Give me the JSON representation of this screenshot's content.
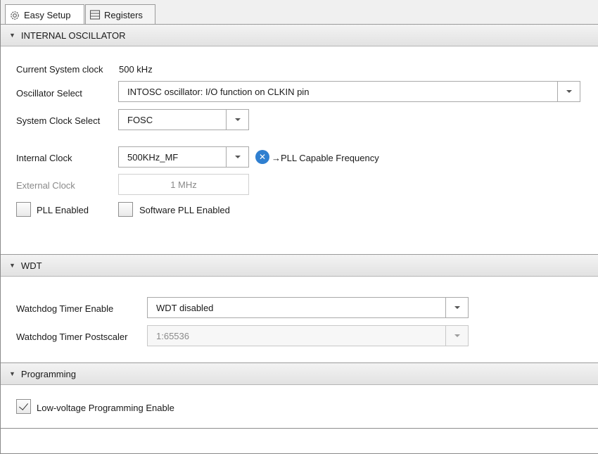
{
  "tabs": [
    {
      "label": "Easy Setup",
      "icon": "gear-icon",
      "active": true
    },
    {
      "label": "Registers",
      "icon": "list-icon",
      "active": false
    }
  ],
  "internal_oscillator": {
    "title": "INTERNAL OSCILLATOR",
    "current_clock_label": "Current System clock",
    "current_clock_value": "500 kHz",
    "osc_select_label": "Oscillator Select",
    "osc_select_value": "INTOSC oscillator: I/O function on CLKIN pin",
    "sys_clock_label": "System Clock Select",
    "sys_clock_value": "FOSC",
    "internal_clock_label": "Internal Clock",
    "internal_clock_value": "500KHz_MF",
    "pll_message": "→PLL Capable Frequency",
    "external_clock_label": "External Clock",
    "external_clock_value": "1 MHz",
    "pll_enabled_label": "PLL Enabled",
    "pll_enabled": false,
    "sw_pll_label": "Software PLL Enabled",
    "sw_pll_enabled": false
  },
  "wdt": {
    "title": "WDT",
    "enable_label": "Watchdog Timer Enable",
    "enable_value": "WDT disabled",
    "postscaler_label": "Watchdog Timer Postscaler",
    "postscaler_value": "1:65536"
  },
  "programming": {
    "title": "Programming",
    "lvp_label": "Low-voltage Programming Enable",
    "lvp_enabled": true
  },
  "colors": {
    "info_icon": "#2f7fd0",
    "header_bg": "#e8e8e8"
  }
}
